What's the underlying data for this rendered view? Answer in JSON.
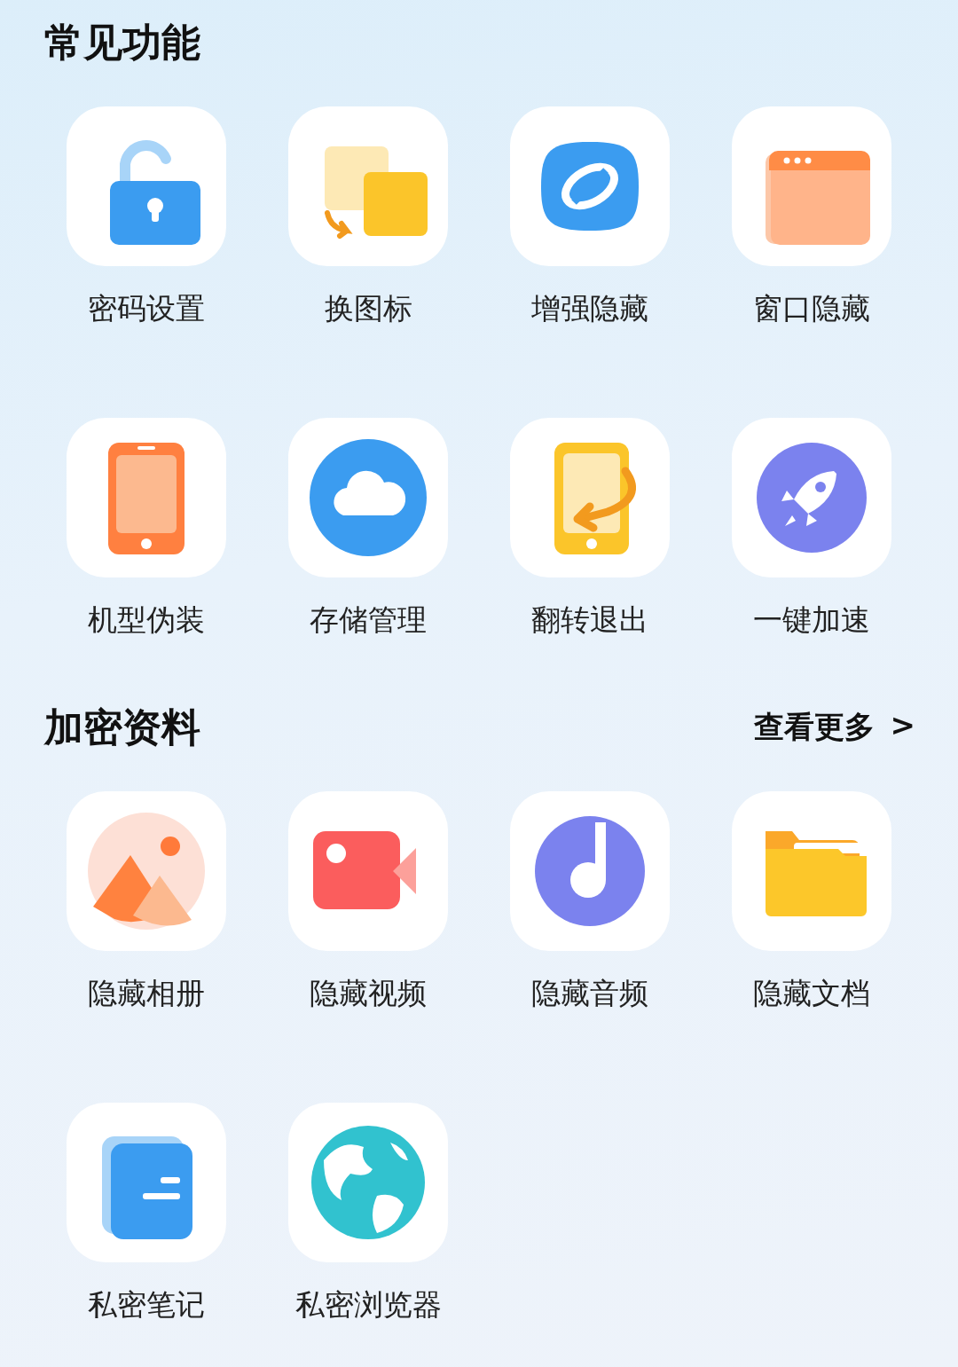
{
  "sections": [
    {
      "title": "常见功能",
      "items": [
        {
          "label": "密码设置"
        },
        {
          "label": "换图标"
        },
        {
          "label": "增强隐藏"
        },
        {
          "label": "窗口隐藏"
        },
        {
          "label": "机型伪装"
        },
        {
          "label": "存储管理"
        },
        {
          "label": "翻转退出"
        },
        {
          "label": "一键加速"
        }
      ]
    },
    {
      "title": "加密资料",
      "more": "查看更多",
      "more_arrow": ">",
      "items": [
        {
          "label": "隐藏相册"
        },
        {
          "label": "隐藏视频"
        },
        {
          "label": "隐藏音频"
        },
        {
          "label": "隐藏文档"
        },
        {
          "label": "私密笔记"
        },
        {
          "label": "私密浏览器"
        }
      ]
    }
  ]
}
